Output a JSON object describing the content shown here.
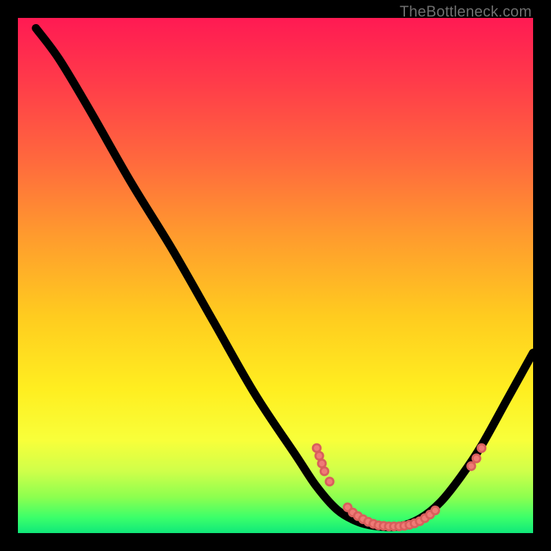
{
  "attribution": "TheBottleneck.com",
  "colors": {
    "dot_fill": "#ef7a76",
    "curve_stroke": "#000000",
    "frame": "#000000"
  },
  "chart_data": {
    "type": "line",
    "title": "",
    "xlabel": "",
    "ylabel": "",
    "xlim": [
      0,
      100
    ],
    "ylim": [
      0,
      100
    ],
    "curve": [
      {
        "x": 3.5,
        "y": 98
      },
      {
        "x": 8,
        "y": 92
      },
      {
        "x": 14,
        "y": 82
      },
      {
        "x": 22,
        "y": 68
      },
      {
        "x": 30,
        "y": 55
      },
      {
        "x": 38,
        "y": 41
      },
      {
        "x": 46,
        "y": 27
      },
      {
        "x": 54,
        "y": 15
      },
      {
        "x": 58,
        "y": 9
      },
      {
        "x": 62,
        "y": 4.5
      },
      {
        "x": 66,
        "y": 2.2
      },
      {
        "x": 70,
        "y": 1.3
      },
      {
        "x": 74,
        "y": 1.3
      },
      {
        "x": 78,
        "y": 2.8
      },
      {
        "x": 82,
        "y": 6
      },
      {
        "x": 86,
        "y": 11
      },
      {
        "x": 90,
        "y": 17
      },
      {
        "x": 95,
        "y": 26
      },
      {
        "x": 100,
        "y": 35
      }
    ],
    "dots": [
      {
        "x": 58,
        "y": 16.5
      },
      {
        "x": 58.5,
        "y": 15
      },
      {
        "x": 59,
        "y": 13.5
      },
      {
        "x": 59.5,
        "y": 12
      },
      {
        "x": 60.5,
        "y": 10
      },
      {
        "x": 64,
        "y": 5
      },
      {
        "x": 65,
        "y": 4
      },
      {
        "x": 66,
        "y": 3.3
      },
      {
        "x": 67,
        "y": 2.7
      },
      {
        "x": 68,
        "y": 2.2
      },
      {
        "x": 69,
        "y": 1.8
      },
      {
        "x": 70,
        "y": 1.5
      },
      {
        "x": 71,
        "y": 1.4
      },
      {
        "x": 72,
        "y": 1.3
      },
      {
        "x": 73,
        "y": 1.3
      },
      {
        "x": 74,
        "y": 1.3
      },
      {
        "x": 75,
        "y": 1.4
      },
      {
        "x": 76,
        "y": 1.6
      },
      {
        "x": 77,
        "y": 1.9
      },
      {
        "x": 78,
        "y": 2.3
      },
      {
        "x": 79,
        "y": 2.9
      },
      {
        "x": 80,
        "y": 3.6
      },
      {
        "x": 81,
        "y": 4.4
      },
      {
        "x": 88,
        "y": 13
      },
      {
        "x": 89,
        "y": 14.5
      },
      {
        "x": 90,
        "y": 16.5
      }
    ]
  }
}
